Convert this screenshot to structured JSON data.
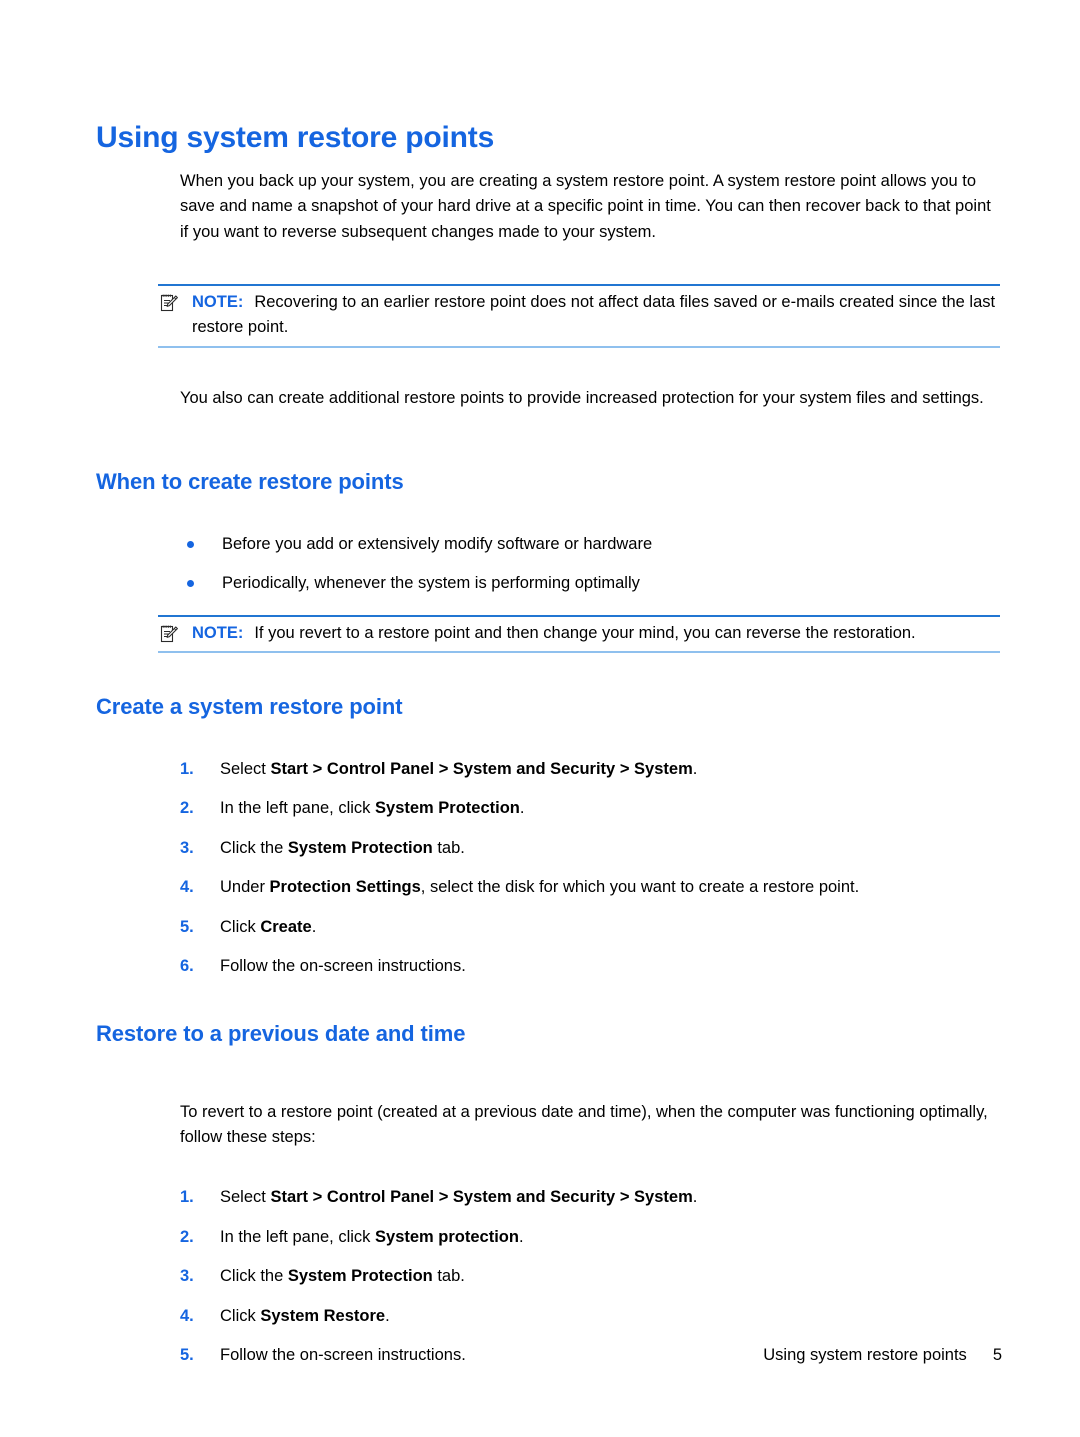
{
  "document": {
    "title": "Using system restore points",
    "accent_color": "#1565E0",
    "rule_top_color": "#2176D2",
    "rule_bottom_color": "#8FC0EE"
  },
  "intro": {
    "paragraph": "When you back up your system, you are creating a system restore point. A system restore point allows you to save and name a snapshot of your hard drive at a specific point in time. You can then recover back to that point if you want to reverse subsequent changes made to your system."
  },
  "note1": {
    "icon": "note-pencil-icon",
    "label": "NOTE:",
    "text": "Recovering to an earlier restore point does not affect data files saved or e-mails created since the last restore point."
  },
  "para2": {
    "text": "You also can create additional restore points to provide increased protection for your system files and settings."
  },
  "section_when": {
    "heading": "When to create restore points",
    "bullets": [
      "Before you add or extensively modify software or hardware",
      "Periodically, whenever the system is performing optimally"
    ]
  },
  "note2": {
    "icon": "note-pencil-icon",
    "label": "NOTE:",
    "text": "If you revert to a restore point and then change your mind, you can reverse the restoration."
  },
  "section_create": {
    "heading": "Create a system restore point",
    "steps": [
      {
        "num": "1.",
        "pre": "Select ",
        "bold": "Start > Control Panel > System and Security > System",
        "post": "."
      },
      {
        "num": "2.",
        "pre": "In the left pane, click ",
        "bold": "System Protection",
        "post": "."
      },
      {
        "num": "3.",
        "pre": "Click the ",
        "bold": "System Protection",
        "post": " tab."
      },
      {
        "num": "4.",
        "pre": "Under ",
        "bold": "Protection Settings",
        "post": ", select the disk for which you want to create a restore point."
      },
      {
        "num": "5.",
        "pre": "Click ",
        "bold": "Create",
        "post": "."
      },
      {
        "num": "6.",
        "pre": "Follow the on-screen instructions.",
        "bold": "",
        "post": ""
      }
    ]
  },
  "section_restore": {
    "heading": "Restore to a previous date and time",
    "intro": "To revert to a restore point (created at a previous date and time), when the computer was functioning optimally, follow these steps:",
    "steps": [
      {
        "num": "1.",
        "pre": "Select ",
        "bold": "Start > Control Panel > System and Security > System",
        "post": "."
      },
      {
        "num": "2.",
        "pre": "In the left pane, click ",
        "bold": "System protection",
        "post": "."
      },
      {
        "num": "3.",
        "pre": "Click the ",
        "bold": "System Protection",
        "post": " tab."
      },
      {
        "num": "4.",
        "pre": "Click ",
        "bold": "System Restore",
        "post": "."
      },
      {
        "num": "5.",
        "pre": "Follow the on-screen instructions.",
        "bold": "",
        "post": ""
      }
    ]
  },
  "footer": {
    "label": "Using system restore points",
    "page_number": "5"
  }
}
